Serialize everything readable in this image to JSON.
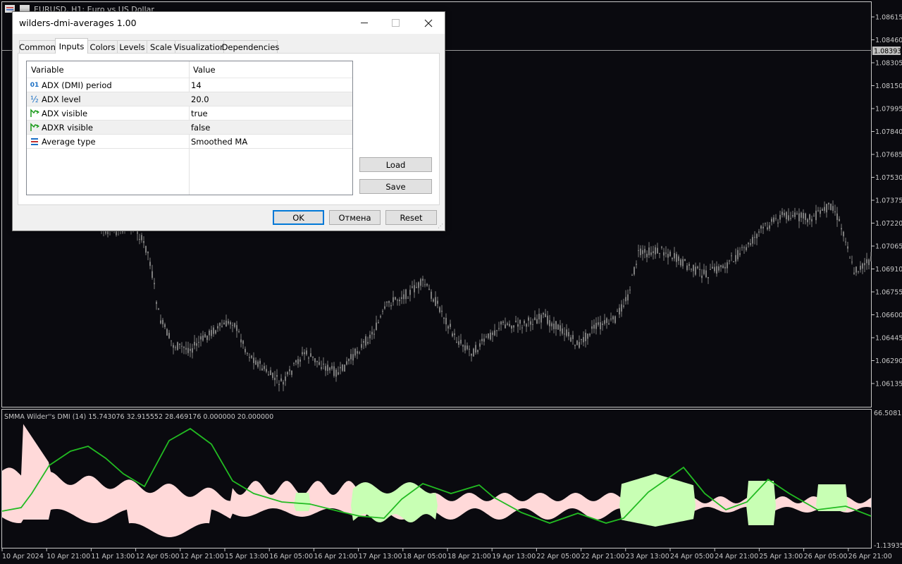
{
  "chart": {
    "symbol_title": "EURUSD, H1:  Euro vs US Dollar",
    "current_price": "1.08393",
    "price_labels": [
      "1.08615",
      "1.08460",
      "1.08305",
      "1.08150",
      "1.07995",
      "1.07840",
      "1.07685",
      "1.07530",
      "1.07375",
      "1.07220",
      "1.07065",
      "1.06910",
      "1.06755",
      "1.06600",
      "1.06445",
      "1.06290",
      "1.06135"
    ],
    "indicator_title": "SMMA Wilder''s DMI (14) 15.743076 32.915552 28.469176 0.000000 20.000000",
    "indicator_max": "66.508136",
    "indicator_min": "-1.139357",
    "time_labels": [
      "10 Apr 2024",
      "10 Apr 21:00",
      "11 Apr 13:00",
      "12 Apr 05:00",
      "12 Apr 21:00",
      "15 Apr 13:00",
      "16 Apr 05:00",
      "16 Apr 21:00",
      "17 Apr 13:00",
      "18 Apr 05:00",
      "18 Apr 21:00",
      "19 Apr 13:00",
      "22 Apr 05:00",
      "22 Apr 21:00",
      "23 Apr 13:00",
      "24 Apr 05:00",
      "24 Apr 21:00",
      "25 Apr 13:00",
      "26 Apr 05:00",
      "26 Apr 21:00"
    ],
    "colors": {
      "background": "#0a0a0f",
      "candle": "#7d7d7d",
      "adx_line": "#22bb22",
      "plus_fill": "#c8ffb4",
      "minus_fill": "#ffd9d9",
      "separator": "#c8c8c8"
    }
  },
  "dialog": {
    "title": "wilders-dmi-averages 1.00",
    "tabs": [
      "Common",
      "Inputs",
      "Colors",
      "Levels",
      "Scale",
      "Visualization",
      "Dependencies"
    ],
    "active_tab": "Inputs",
    "grid_header": {
      "variable": "Variable",
      "value": "Value"
    },
    "rows": [
      {
        "icon": "integer-icon",
        "variable": "ADX (DMI) period",
        "value": "14"
      },
      {
        "icon": "fraction-icon",
        "variable": "ADX level",
        "value": "20.0"
      },
      {
        "icon": "bool-icon",
        "variable": "ADX visible",
        "value": "true"
      },
      {
        "icon": "bool-icon",
        "variable": "ADXR visible",
        "value": "false"
      },
      {
        "icon": "enum-icon",
        "variable": "Average type",
        "value": "Smoothed MA"
      }
    ],
    "buttons": {
      "load": "Load",
      "save": "Save",
      "ok": "OK",
      "cancel": "Отмена",
      "reset": "Reset"
    }
  }
}
